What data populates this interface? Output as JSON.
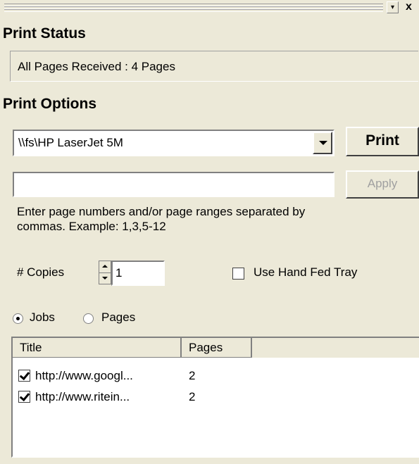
{
  "titlebar": {
    "minimize_glyph": "▾",
    "close_glyph": "x"
  },
  "print_status": {
    "heading": "Print Status",
    "message": "All Pages Received : 4 Pages"
  },
  "print_options": {
    "heading": "Print Options",
    "printer_selected": "\\\\fs\\HP LaserJet 5M",
    "print_label": "Print",
    "pages_value": "",
    "apply_label": "Apply",
    "help_text_line1": "Enter page numbers and/or page ranges separated by",
    "help_text_line2": "commas.  Example:  1,3,5-12",
    "copies_label": "# Copies",
    "copies_value": "1",
    "hand_fed_label": "Use Hand Fed Tray",
    "hand_fed_checked": false
  },
  "view_mode": {
    "jobs_label": "Jobs",
    "pages_label": "Pages",
    "selected": "Jobs"
  },
  "jobs_list": {
    "columns": [
      "Title",
      "Pages"
    ],
    "rows": [
      {
        "title": "http://www.googl...",
        "pages": "2",
        "checked": true
      },
      {
        "title": "http://www.ritein...",
        "pages": "2",
        "checked": true
      }
    ]
  }
}
